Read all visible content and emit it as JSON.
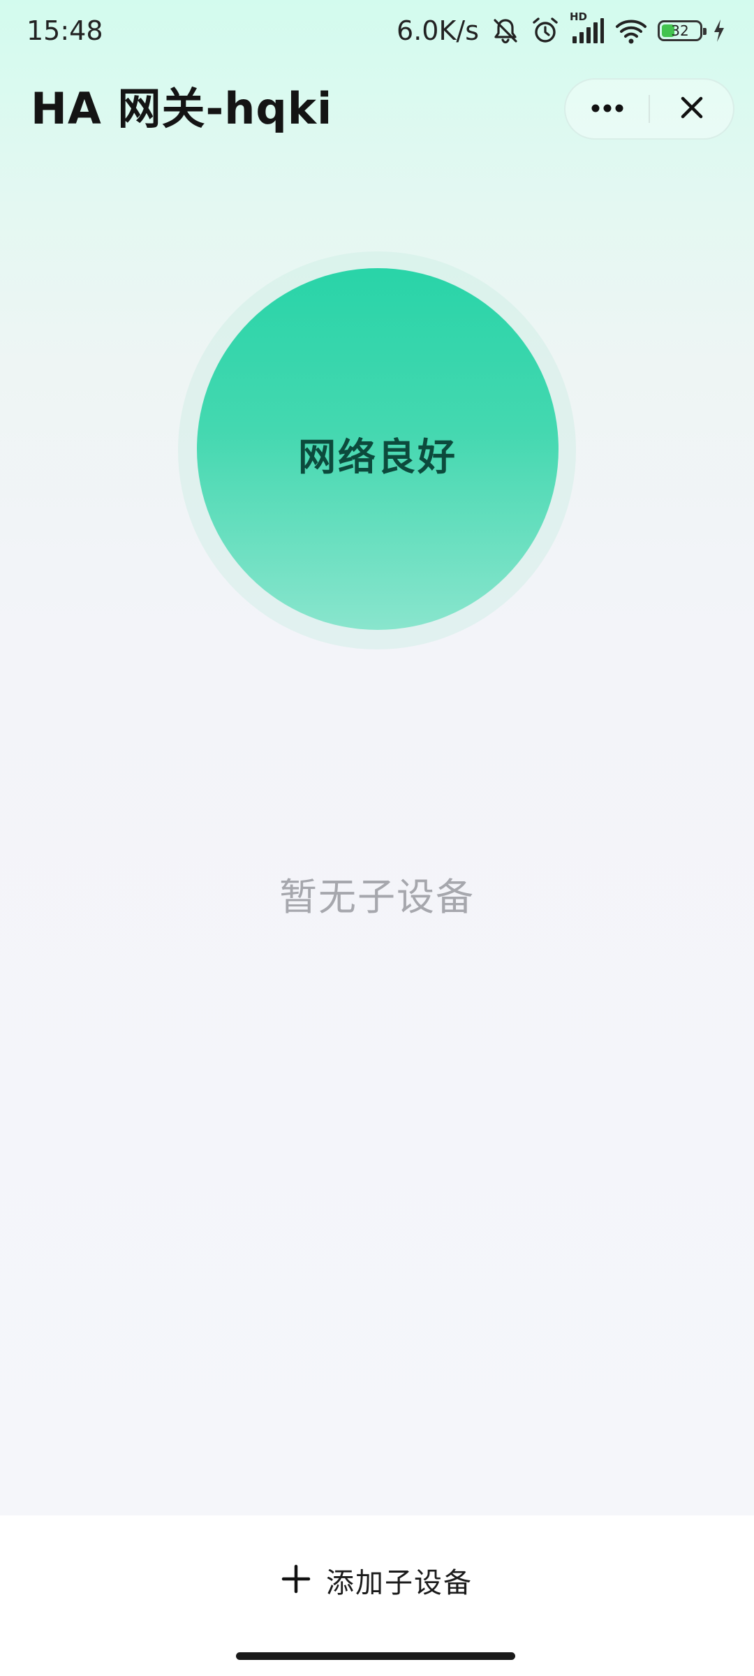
{
  "status_bar": {
    "time": "15:48",
    "net_speed": "6.0K/s",
    "network_label": "HD",
    "battery_level": "32",
    "battery_charging": true,
    "icons": [
      "bell-muted-icon",
      "alarm-icon",
      "cellular-signal-icon",
      "wifi-icon",
      "battery-icon",
      "charging-icon"
    ]
  },
  "header": {
    "title": "HA 网关-hqki",
    "more_icon": "more-dots-icon",
    "close_icon": "close-icon"
  },
  "network_status": {
    "label": "网络良好",
    "color": "#2cd4a8"
  },
  "devices": {
    "empty_text": "暂无子设备"
  },
  "bottom": {
    "add_label": "添加子设备",
    "add_icon": "plus-icon"
  }
}
